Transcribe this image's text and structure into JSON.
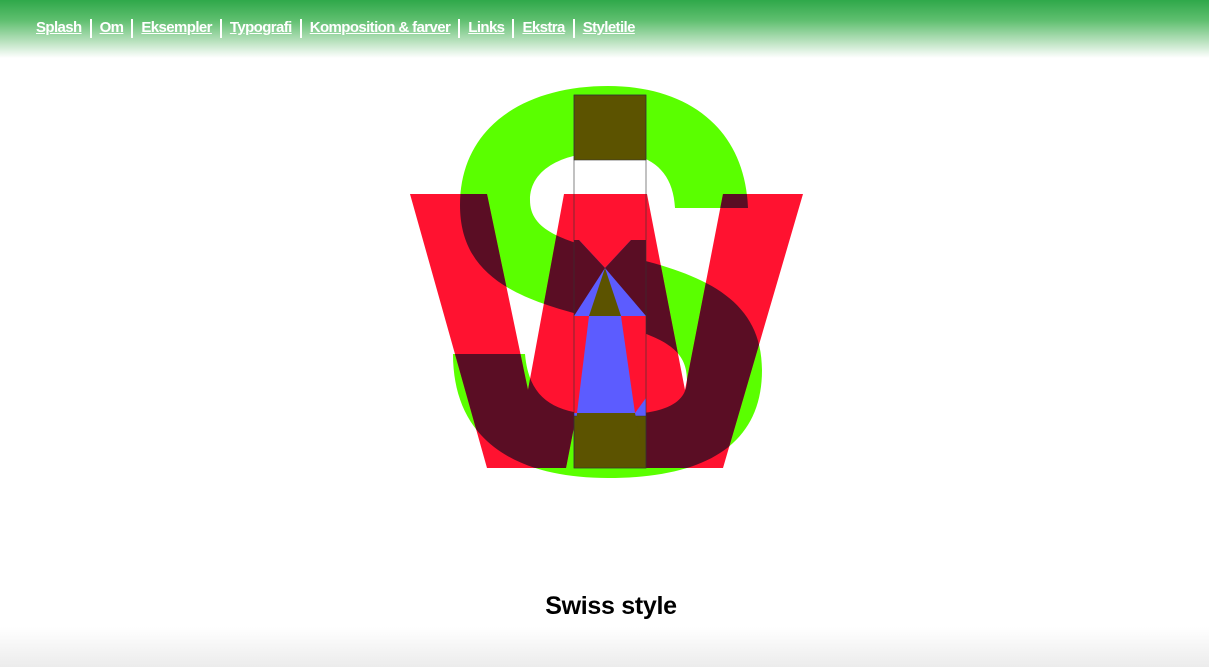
{
  "nav": {
    "items": [
      {
        "label": "Splash"
      },
      {
        "label": "Om"
      },
      {
        "label": "Eksempler"
      },
      {
        "label": "Typografi"
      },
      {
        "label": "Komposition & farver"
      },
      {
        "label": "Links"
      },
      {
        "label": "Ekstra"
      },
      {
        "label": "Styletile"
      }
    ]
  },
  "hero": {
    "caption": "Swiss style"
  },
  "colors": {
    "header_green": "#2fa84a",
    "logo_green": "#5aff00",
    "logo_red": "#ff1230",
    "logo_blue": "#5c5cff",
    "logo_overlap_dark": "#5a0d24",
    "logo_overlap_olive": "#5c5300"
  }
}
